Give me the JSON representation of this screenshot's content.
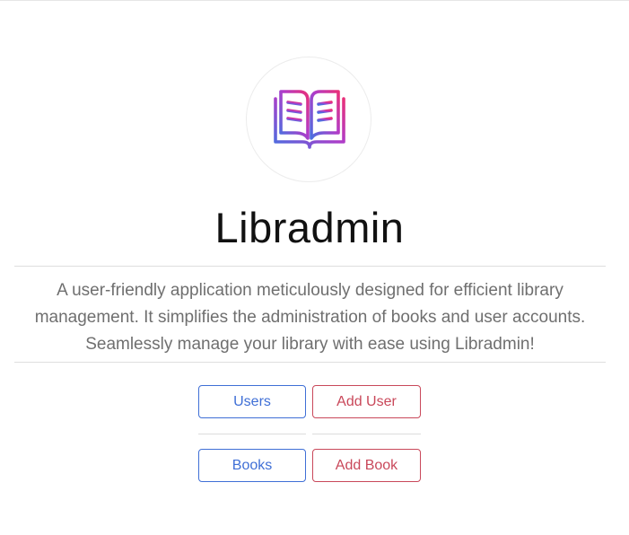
{
  "app": {
    "title": "Libradmin",
    "description": "A user-friendly application meticulously designed for efficient library management. It simplifies the administration of books and user accounts. Seamlessly manage your library with ease using Libradmin!",
    "logo_icon": "open-book-icon"
  },
  "actions": {
    "users_label": "Users",
    "add_user_label": "Add User",
    "books_label": "Books",
    "add_book_label": "Add Book"
  },
  "colors": {
    "primary": "#3f6fd6",
    "danger": "#c9485a",
    "logo_gradient_start": "#4a6fe0",
    "logo_gradient_mid": "#b03cc8",
    "logo_gradient_end": "#e8307a"
  }
}
